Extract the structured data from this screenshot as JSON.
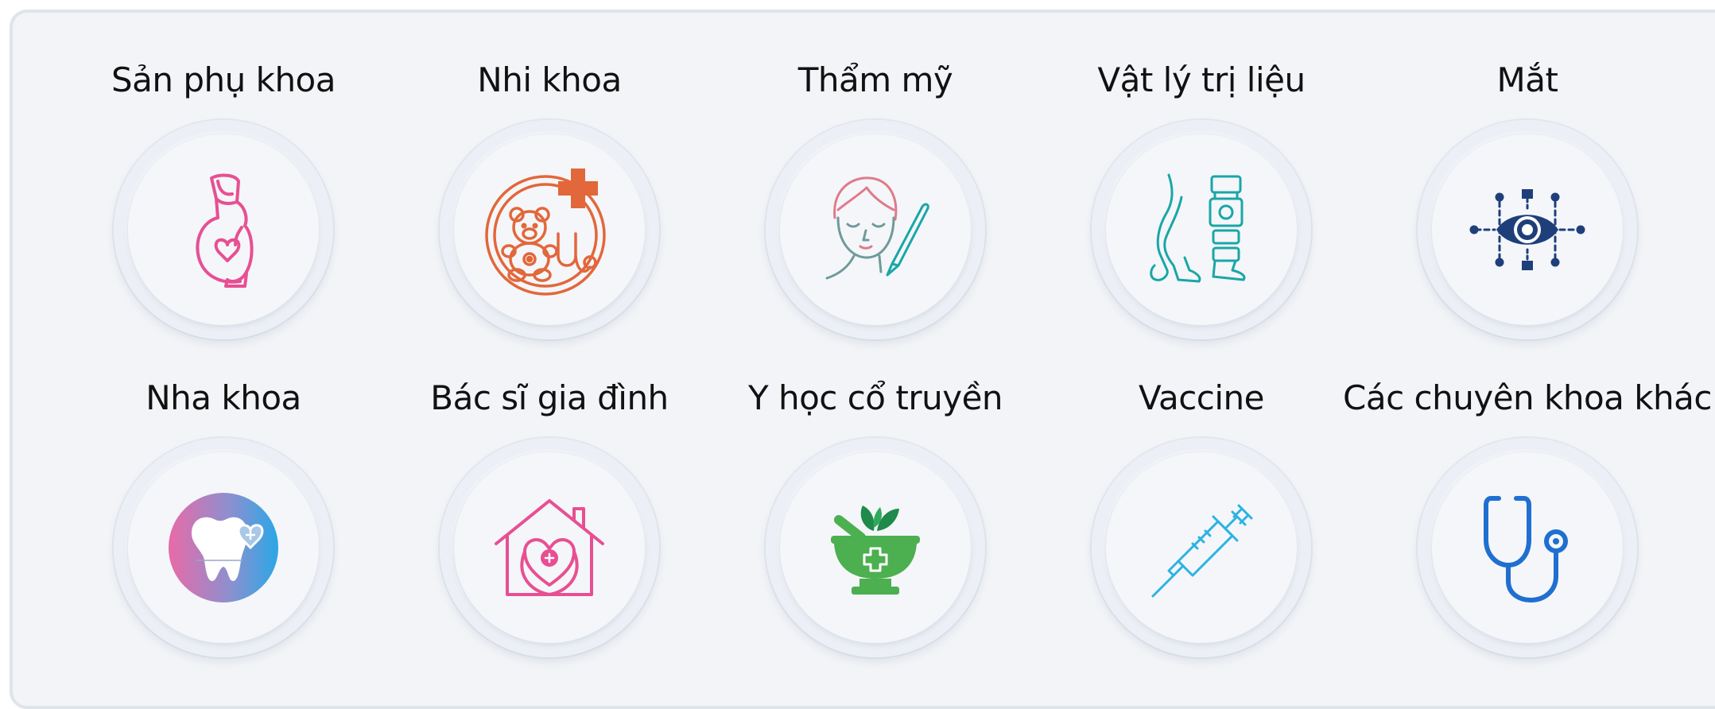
{
  "specialties": [
    {
      "label": "Sản phụ khoa",
      "icon": "pregnant-woman-icon",
      "color": "#e84f92"
    },
    {
      "label": "Nhi khoa",
      "icon": "teddy-bear-stethoscope-icon",
      "color": "#e2673a"
    },
    {
      "label": "Thẩm mỹ",
      "icon": "face-scalpel-icon",
      "color": "#e07a8a"
    },
    {
      "label": "Vật lý trị liệu",
      "icon": "leg-brace-icon",
      "color": "#1aa6a6"
    },
    {
      "label": "Mắt",
      "icon": "eye-scan-icon",
      "color": "#1f3f7a"
    },
    {
      "label": "Nha khoa",
      "icon": "tooth-icon",
      "color": "#3aa3e3"
    },
    {
      "label": "Bác sĩ gia đình",
      "icon": "home-heart-icon",
      "color": "#e84f92"
    },
    {
      "label": "Y học cổ truyền",
      "icon": "herbal-mortar-icon",
      "color": "#4caf50"
    },
    {
      "label": "Vaccine",
      "icon": "syringe-icon",
      "color": "#2bb3e3"
    },
    {
      "label": "Các chuyên khoa khác",
      "icon": "stethoscope-icon",
      "color": "#1f6fd1"
    }
  ]
}
